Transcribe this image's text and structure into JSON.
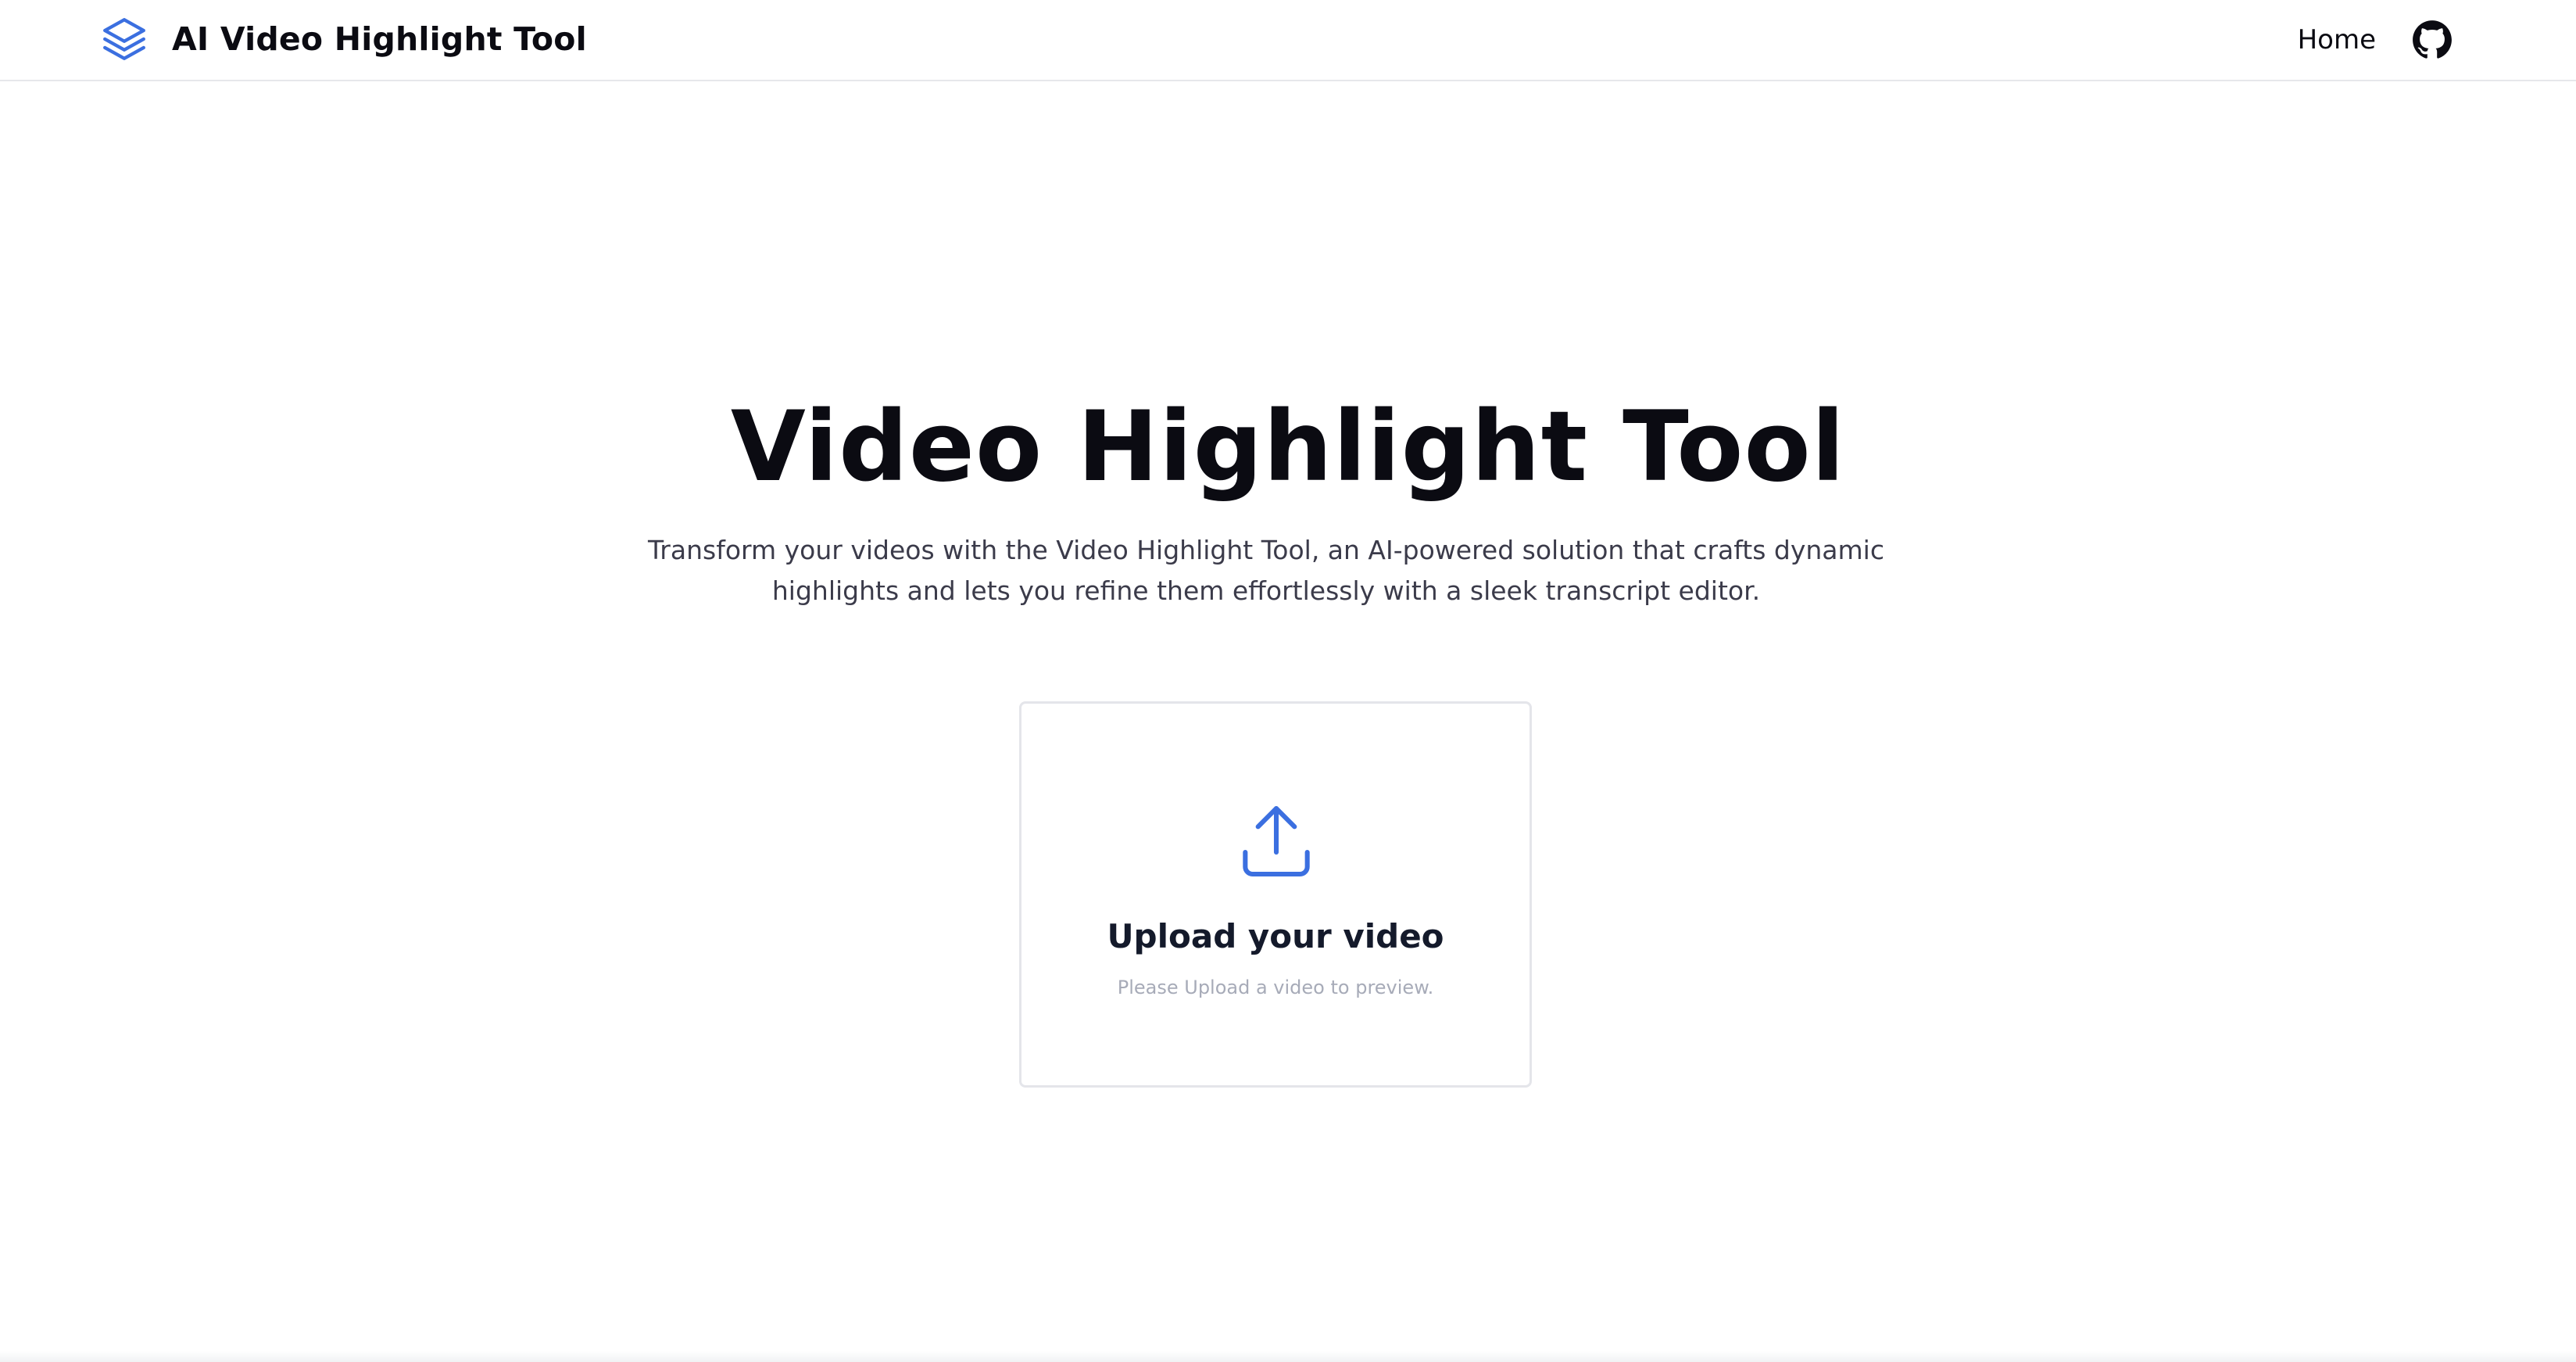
{
  "header": {
    "brand_title": "AI Video Highlight Tool",
    "brand_icon": "layers-icon",
    "nav_home": "Home",
    "github_icon": "github-icon"
  },
  "hero": {
    "title": "Video Highlight Tool",
    "description": "Transform your videos with the Video Highlight Tool, an AI-powered solution that crafts dynamic highlights and lets you refine them effortlessly with a sleek transcript editor."
  },
  "upload": {
    "icon": "upload-icon",
    "title": "Upload your video",
    "hint": "Please Upload a video to preview."
  },
  "colors": {
    "accent": "#3b6fe0",
    "text_primary": "#0b0b12",
    "text_secondary": "#3b3b4a",
    "hint": "#a7abb8",
    "border": "#e4e5ea"
  }
}
